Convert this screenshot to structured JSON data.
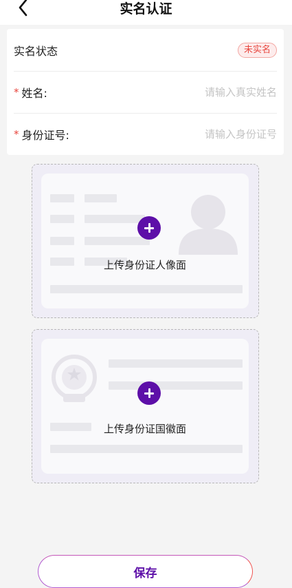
{
  "header": {
    "title": "实名认证"
  },
  "form": {
    "status": {
      "label": "实名状态",
      "badge": "未实名",
      "badge_color": "#e8473f"
    },
    "name": {
      "required_mark": "*",
      "label": "姓名:",
      "placeholder": "请输入真实姓名"
    },
    "id_number": {
      "required_mark": "*",
      "label": "身份证号:",
      "placeholder": "请输入身份证号"
    }
  },
  "uploads": {
    "front": {
      "label": "上传身份证人像面"
    },
    "back": {
      "label": "上传身份证国徽面"
    }
  },
  "actions": {
    "save": "保存"
  },
  "colors": {
    "accent": "#5d0fa8",
    "required": "#e8473f"
  },
  "icons": {
    "back": "chevron-left-icon",
    "upload": "plus-circle-icon",
    "portrait": "person-silhouette-icon",
    "emblem": "national-emblem-icon"
  }
}
